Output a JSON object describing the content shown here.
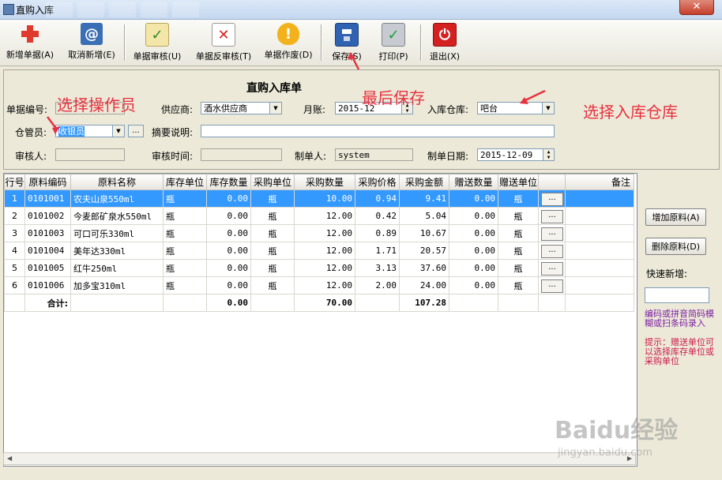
{
  "window": {
    "title": "直购入库",
    "close_label": "✕"
  },
  "toolbar": {
    "buttons": [
      {
        "label": "新增单据(A)"
      },
      {
        "label": "取消新增(E)"
      },
      {
        "label": "单据审核(U)"
      },
      {
        "label": "单据反审核(T)"
      },
      {
        "label": "单据作废(D)"
      },
      {
        "label": "保存(S)"
      },
      {
        "label": "打印(P)"
      },
      {
        "label": "退出(X)"
      }
    ]
  },
  "form": {
    "title": "直购入库单",
    "doc_no_label": "单据编号:",
    "doc_no_value": "",
    "supplier_label": "供应商:",
    "supplier_value": "酒水供应商",
    "period_label": "月账:",
    "period_value": "2015-12",
    "warehouse_label": "入库仓库:",
    "warehouse_value": "吧台",
    "keeper_label": "仓管员:",
    "keeper_value": "收银员",
    "keeper_btn": "...",
    "summary_label": "摘要说明:",
    "summary_value": "",
    "reviewer_label": "审核人:",
    "reviewer_value": "",
    "review_time_label": "审核时间:",
    "review_time_value": "",
    "maker_label": "制单人:",
    "maker_value": "system",
    "make_date_label": "制单日期:",
    "make_date_value": "2015-12-09"
  },
  "annotations": {
    "select_operator": "选择操作员",
    "save_last": "最后保存",
    "select_warehouse": "选择入库仓库"
  },
  "grid": {
    "columns": [
      "行号",
      "原料编码",
      "原料名称",
      "库存单位",
      "库存数量",
      "采购单位",
      "采购数量",
      "采购价格",
      "采购金额",
      "赠送数量",
      "赠送单位",
      "",
      "备注"
    ],
    "rows": [
      {
        "no": "1",
        "code": "0101001",
        "name": "农夫山泉550ml",
        "stock_unit": "瓶",
        "stock_qty": "0.00",
        "buy_unit": "瓶",
        "buy_qty": "10.00",
        "price": "0.94",
        "amount": "9.41",
        "gift_qty": "0.00",
        "gift_unit": "瓶",
        "btn": "...",
        "note": ""
      },
      {
        "no": "2",
        "code": "0101002",
        "name": "今麦郎矿泉水550ml",
        "stock_unit": "瓶",
        "stock_qty": "0.00",
        "buy_unit": "瓶",
        "buy_qty": "12.00",
        "price": "0.42",
        "amount": "5.04",
        "gift_qty": "0.00",
        "gift_unit": "瓶",
        "btn": "...",
        "note": ""
      },
      {
        "no": "3",
        "code": "0101003",
        "name": "可口可乐330ml",
        "stock_unit": "瓶",
        "stock_qty": "0.00",
        "buy_unit": "瓶",
        "buy_qty": "12.00",
        "price": "0.89",
        "amount": "10.67",
        "gift_qty": "0.00",
        "gift_unit": "瓶",
        "btn": "...",
        "note": ""
      },
      {
        "no": "4",
        "code": "0101004",
        "name": "美年达330ml",
        "stock_unit": "瓶",
        "stock_qty": "0.00",
        "buy_unit": "瓶",
        "buy_qty": "12.00",
        "price": "1.71",
        "amount": "20.57",
        "gift_qty": "0.00",
        "gift_unit": "瓶",
        "btn": "...",
        "note": ""
      },
      {
        "no": "5",
        "code": "0101005",
        "name": "红牛250ml",
        "stock_unit": "瓶",
        "stock_qty": "0.00",
        "buy_unit": "瓶",
        "buy_qty": "12.00",
        "price": "3.13",
        "amount": "37.60",
        "gift_qty": "0.00",
        "gift_unit": "瓶",
        "btn": "...",
        "note": ""
      },
      {
        "no": "6",
        "code": "0101006",
        "name": "加多宝310ml",
        "stock_unit": "瓶",
        "stock_qty": "0.00",
        "buy_unit": "瓶",
        "buy_qty": "12.00",
        "price": "2.00",
        "amount": "24.00",
        "gift_qty": "0.00",
        "gift_unit": "瓶",
        "btn": "...",
        "note": ""
      }
    ],
    "total": {
      "label": "合计:",
      "stock_qty": "0.00",
      "buy_qty": "70.00",
      "amount": "107.28"
    }
  },
  "side": {
    "add_material": "增加原料(A)",
    "delete_material": "删除原料(D)",
    "quick_add_label": "快速新增:",
    "quick_add_value": "",
    "hint_code": "编码或拼音简码模糊或扫条码录入",
    "hint_gift": "提示：赠送单位可以选择库存单位或采购单位"
  },
  "watermark": {
    "brand": "Baidu经验",
    "url": "jingyan.baidu.com"
  },
  "colors": {
    "selection": "#3399ff",
    "annotation": "#e8313f",
    "hint_purple": "#7a1fa2",
    "hint_red": "#cc1a4a"
  }
}
